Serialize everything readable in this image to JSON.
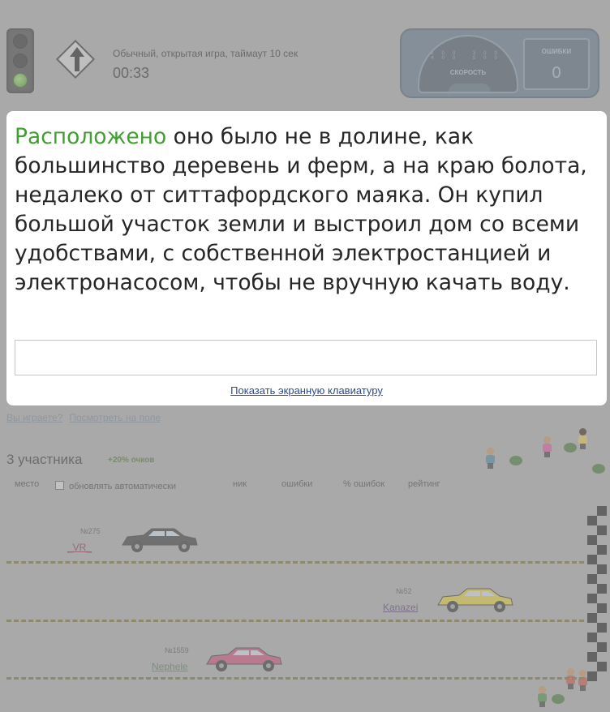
{
  "header": {
    "game_mode": "Обычный, открытая игра, таймаут 10 сек",
    "timer": "00:33",
    "dashboard": {
      "speed_label": "СКОРОСТЬ",
      "speed_ticks": "200 300 400 500",
      "errors_label": "ОШИБКИ",
      "errors_value": "0"
    }
  },
  "typing": {
    "typed_word": "Расположено",
    "remaining_text": " оно было не в долине, как большинство деревень и ферм, а на краю болота, недалеко от ситтафордского маяка. Он купил большой участок земли и выстроил дом со всеми удобствами, с собственной электростанцией и электронасосом, чтобы не вручную качать воду.",
    "input_value": "",
    "keyboard_link": "Показать экранную клавиатуру"
  },
  "help_links": [
    "Вы играете?",
    "Посмотреть на поле"
  ],
  "race": {
    "participants": "3 участника",
    "bonus": "+20% очков",
    "columns": {
      "place": "место",
      "auto_update": "обновлять автоматически",
      "nick": "ник",
      "errors": "ошибки",
      "error_pct": "% ошибок",
      "rating": "рейтинг"
    },
    "racers": [
      {
        "rank": "№275",
        "nick": "_VR_",
        "nick_color": "#7a1e3e",
        "car_color": "#2a2a2a",
        "progress": 0.15
      },
      {
        "rank": "№52",
        "nick": "Kanazei",
        "nick_color": "#4a2a6a",
        "car_color": "#e2cf2a",
        "progress": 0.82
      },
      {
        "rank": "№1559",
        "nick": "Nephele",
        "nick_color": "#4a6a4a",
        "car_color": "#c84070",
        "progress": 0.33
      }
    ]
  },
  "colors": {
    "overlay": "#a9a9a9",
    "typed": "#3f9f2f",
    "link": "#2a4a8a"
  }
}
